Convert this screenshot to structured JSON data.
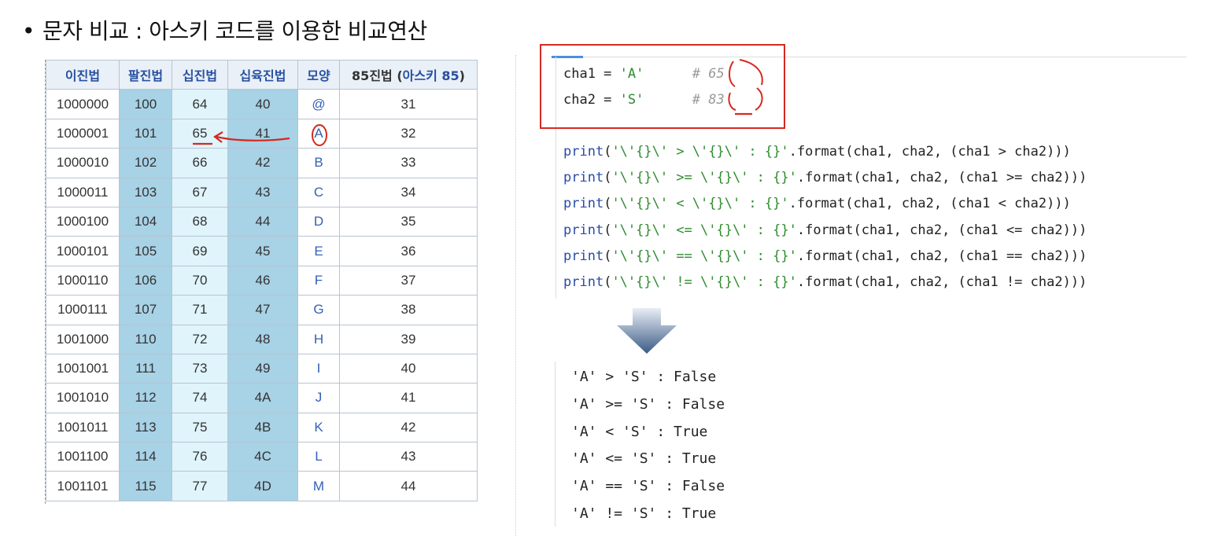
{
  "heading": {
    "bullet": "•",
    "text": "문자 비교 : 아스키 코드를 이용한 비교연산"
  },
  "ascii_table": {
    "headers": [
      "이진법",
      "팔진법",
      "십진법",
      "십육진법",
      "모양",
      "85진법 (",
      "아스키 85",
      ")"
    ],
    "rows": [
      [
        "1000000",
        "100",
        "64",
        "40",
        "@",
        "31"
      ],
      [
        "1000001",
        "101",
        "65",
        "41",
        "A",
        "32"
      ],
      [
        "1000010",
        "102",
        "66",
        "42",
        "B",
        "33"
      ],
      [
        "1000011",
        "103",
        "67",
        "43",
        "C",
        "34"
      ],
      [
        "1000100",
        "104",
        "68",
        "44",
        "D",
        "35"
      ],
      [
        "1000101",
        "105",
        "69",
        "45",
        "E",
        "36"
      ],
      [
        "1000110",
        "106",
        "70",
        "46",
        "F",
        "37"
      ],
      [
        "1000111",
        "107",
        "71",
        "47",
        "G",
        "38"
      ],
      [
        "1001000",
        "110",
        "72",
        "48",
        "H",
        "39"
      ],
      [
        "1001001",
        "111",
        "73",
        "49",
        "I",
        "40"
      ],
      [
        "1001010",
        "112",
        "74",
        "4A",
        "J",
        "41"
      ],
      [
        "1001011",
        "113",
        "75",
        "4B",
        "K",
        "42"
      ],
      [
        "1001100",
        "114",
        "76",
        "4C",
        "L",
        "43"
      ],
      [
        "1001101",
        "115",
        "77",
        "4D",
        "M",
        "44"
      ]
    ]
  },
  "code": {
    "assign": [
      {
        "var": "cha1 = ",
        "val": "'A'",
        "comment_hash": "#",
        "comment_val": "65"
      },
      {
        "var": "cha2 = ",
        "val": "'S'",
        "comment_hash": "#",
        "comment_val": "83"
      }
    ],
    "prints": [
      {
        "fn": "print",
        "open": "(",
        "fmt": "'\\'{}\\' > \\'{}\\' : {}'",
        "rest": ".format(cha1, cha2, (cha1 > cha2)))"
      },
      {
        "fn": "print",
        "open": "(",
        "fmt": "'\\'{}\\' >= \\'{}\\' : {}'",
        "rest": ".format(cha1, cha2, (cha1 >= cha2)))"
      },
      {
        "fn": "print",
        "open": "(",
        "fmt": "'\\'{}\\' < \\'{}\\' : {}'",
        "rest": ".format(cha1, cha2, (cha1 < cha2)))"
      },
      {
        "fn": "print",
        "open": "(",
        "fmt": "'\\'{}\\' <= \\'{}\\' : {}'",
        "rest": ".format(cha1, cha2, (cha1 <= cha2)))"
      },
      {
        "fn": "print",
        "open": "(",
        "fmt": "'\\'{}\\' == \\'{}\\' : {}'",
        "rest": ".format(cha1, cha2, (cha1 == cha2)))"
      },
      {
        "fn": "print",
        "open": "(",
        "fmt": "'\\'{}\\' != \\'{}\\' : {}'",
        "rest": ".format(cha1, cha2, (cha1 != cha2)))"
      }
    ]
  },
  "output": [
    "'A' > 'S' : False",
    "'A' >= 'S' : False",
    "'A' < 'S' : True",
    "'A' <= 'S' : True",
    "'A' == 'S' : False",
    "'A' != 'S' : True"
  ],
  "colors": {
    "highlight_box": "#d42a20",
    "keyword": "#2a4aa8",
    "string": "#2e8b2e",
    "header_text": "#2650a0",
    "binary_col": "#a8d2e6",
    "decimal_col": "#dff4fb"
  },
  "icons": {
    "flow_arrow": "down-arrow-icon"
  }
}
